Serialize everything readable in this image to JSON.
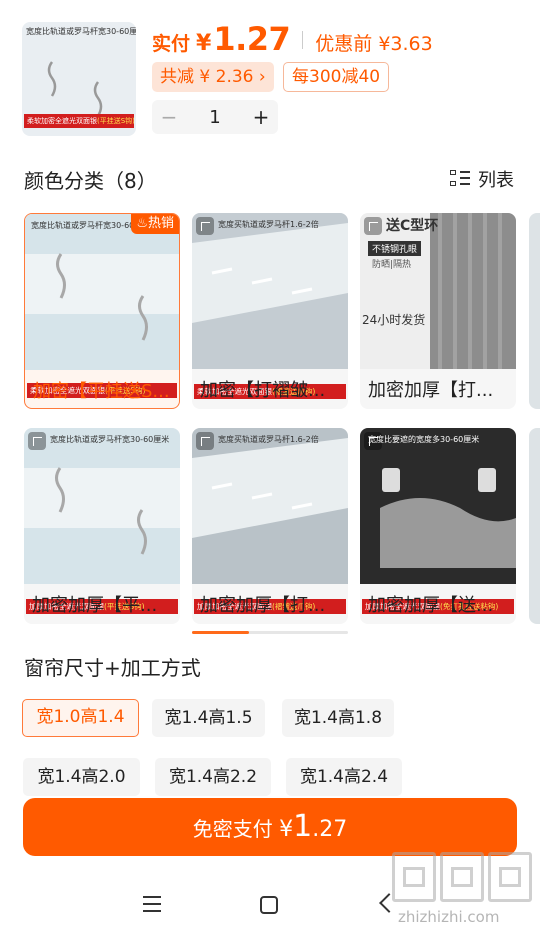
{
  "product": {
    "thumb_caption": "宽度比轨道或罗马杆宽30-60厘米",
    "thumb_band": "柔软加密全遮光双面银",
    "thumb_band_hl": "(平挂送S钩)"
  },
  "price": {
    "label": "实付",
    "currency": "¥",
    "value": "1.27",
    "original": "优惠前 ¥3.63",
    "saved": "共减 ¥ 2.36 ›",
    "promo": "每300减40"
  },
  "quantity": {
    "minus": "−",
    "value": "1",
    "plus": "+"
  },
  "color_section": {
    "title": "颜色分类（8）",
    "view_toggle": "列表"
  },
  "variants": [
    {
      "name": "加密【平挂送S...",
      "caption": "宽度比轨道或罗马杆宽30-60厘米",
      "band": "柔软加密全遮光双面银",
      "band_hl": "(平挂送S钩)",
      "badge": "热销",
      "image": "light-hooks"
    },
    {
      "name": "加密【打褶皱...",
      "caption": "宽度买轨道或罗马杆1.6-2倍",
      "band": "柔软加密全遮光双面银",
      "band_hl": "(褶皱送爪钩)",
      "badge": "",
      "image": "light-pleat"
    },
    {
      "name": "加密加厚【打...",
      "caption": "送C型环",
      "band": "不锈钢孔眼",
      "band_hl": "",
      "badge": "",
      "image": "grey-rings",
      "sub1": "防晒|隔热",
      "sub2": "24小时发货"
    },
    {
      "name": "加密加厚【平...",
      "caption": "宽度比轨道或罗马杆宽30-60厘米",
      "band": "加厚加密全遮光双面银",
      "band_hl": "(平挂送S钩)",
      "badge": "",
      "image": "light-hooks"
    },
    {
      "name": "加密加厚【打...",
      "caption": "宽度买轨道或罗马杆1.6-2倍",
      "band": "加厚加密全遮光双面银",
      "band_hl": "(褶皱送爪钩)",
      "badge": "",
      "image": "light-pleat"
    },
    {
      "name": "加密加厚【送...",
      "caption": "宽度比要遮的宽度多30-60厘米",
      "band": "加厚加密全遮光双面银",
      "band_hl": "(免打孔挂送粘钩)",
      "badge": "",
      "image": "dark-hooks"
    }
  ],
  "size_section": {
    "title": "窗帘尺寸+加工方式",
    "options": [
      "宽1.0高1.4",
      "宽1.4高1.5",
      "宽1.4高1.8",
      "宽1.4高2.0",
      "宽1.4高2.2",
      "宽1.4高2.4"
    ],
    "selected_index": 0
  },
  "pay": {
    "label": "免密支付",
    "currency": "¥",
    "amount_int": "1",
    "amount_dec": ".27"
  },
  "watermark": {
    "url": "zhizhizhi.com"
  },
  "colors": {
    "accent": "#ff5a00",
    "accent_light": "#fde4d7",
    "selected_border": "#ff7a3a",
    "band_red": "#d21e1e"
  }
}
